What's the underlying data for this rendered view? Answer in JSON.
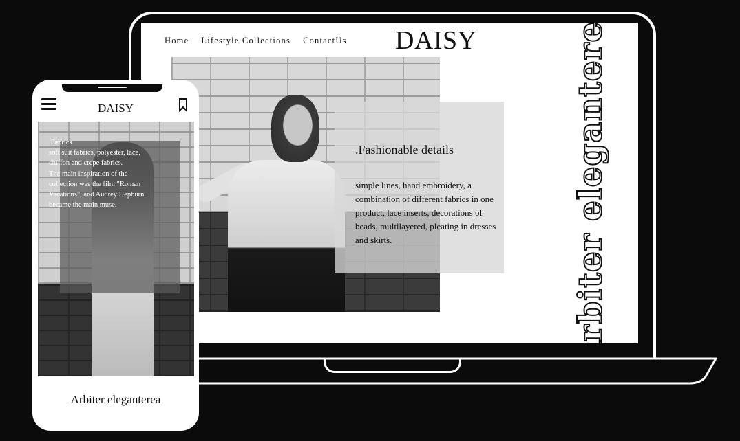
{
  "laptop": {
    "nav": [
      "Home",
      "Lifestyle Collections",
      "ContactUs"
    ],
    "brand": "DAISY",
    "detail_title": ".Fashionable details",
    "detail_text": "simple lines, hand embroidery, a combination of different fabrics in one product, lace inserts, decorations of beads, multilayered, pleating in dresses and skirts.",
    "vertical_title": "Arbiter eleganterea"
  },
  "phone": {
    "brand": "DAISY",
    "fabrics_text": ".Fabrics\nsoft suit fabrics, polyester, lace, chiffon and crepe fabrics.\nThe main inspiration of the collection was the film \"Roman Vacations\", and Audrey Hepburn became the main muse.",
    "caption": "Arbiter eleganterea",
    "icons": {
      "menu": "hamburger-menu-icon",
      "bookmark": "bookmark-icon"
    }
  }
}
